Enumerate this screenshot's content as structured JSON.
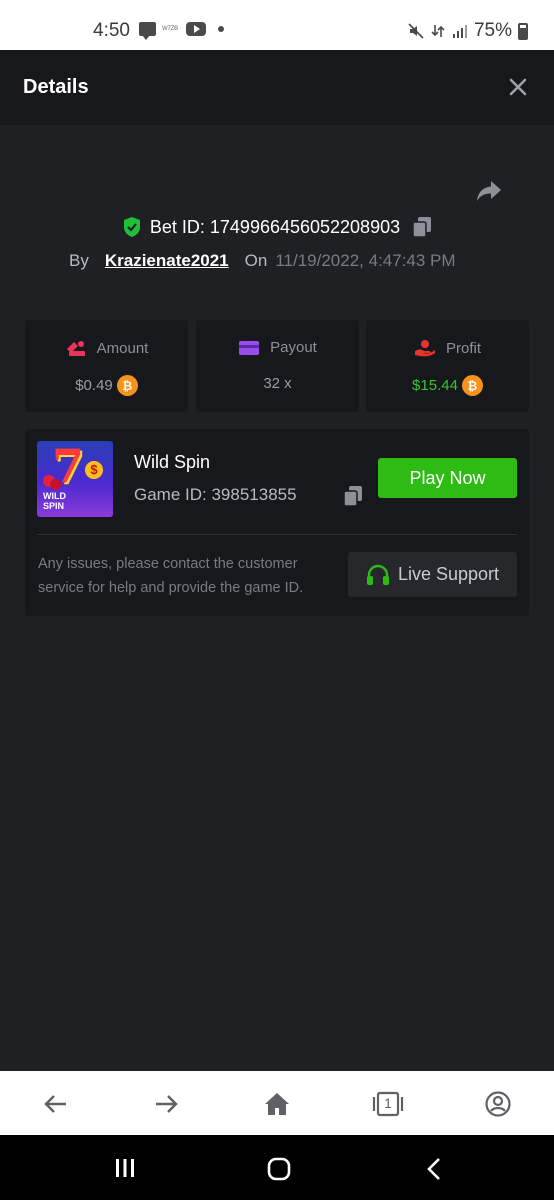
{
  "status_bar": {
    "time": "4:50",
    "small_label": "W7ZB",
    "battery": "75%"
  },
  "header": {
    "title": "Details"
  },
  "bet": {
    "id_label": "Bet ID: 1749966456052208903",
    "by_label": "By",
    "username": "Krazienate2021",
    "on_label": "On",
    "date": "11/19/2022, 4:47:43 PM"
  },
  "stats": {
    "amount": {
      "label": "Amount",
      "value": "$0.49"
    },
    "payout": {
      "label": "Payout",
      "value": "32 x"
    },
    "profit": {
      "label": "Profit",
      "value": "$15.44"
    }
  },
  "game": {
    "thumb_label_line1": "WILD",
    "thumb_label_line2": "SPIN",
    "name": "Wild Spin",
    "id_label": "Game ID: 398513855",
    "play_label": "Play Now",
    "issue_text": "Any issues, please contact the customer service for help and provide the game ID.",
    "support_label": "Live Support"
  },
  "browser_nav": {
    "tab_count": "1"
  },
  "colors": {
    "accent_green": "#2dbb14",
    "profit_green": "#33c533",
    "btc_orange": "#f7931a",
    "shield_green": "#1fbf3a"
  }
}
